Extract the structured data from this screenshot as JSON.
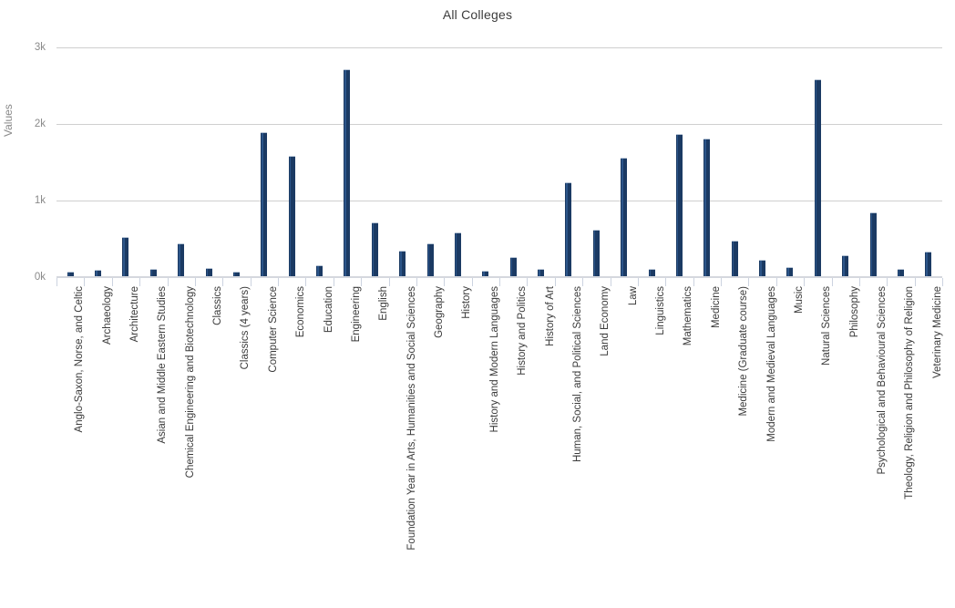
{
  "chart": {
    "title": "All Colleges",
    "ylabel": "Values",
    "ytick_labels": [
      "3k",
      "2k",
      "1k",
      "0k"
    ]
  },
  "chart_data": {
    "type": "bar",
    "title": "All Colleges",
    "xlabel": "",
    "ylabel": "Values",
    "ylim": [
      0,
      3000
    ],
    "yticks": [
      0,
      1000,
      2000,
      3000
    ],
    "ytick_labels": [
      "0k",
      "1k",
      "2k",
      "3k"
    ],
    "grid": true,
    "legend": false,
    "bar_color": "#1b3a63",
    "categories": [
      "Anglo-Saxon, Norse, and Celtic",
      "Archaeology",
      "Architecture",
      "Asian and Middle Eastern Studies",
      "Chemical Engineering and Biotechnology",
      "Classics",
      "Classics (4 years)",
      "Computer Science",
      "Economics",
      "Education",
      "Engineering",
      "English",
      "Foundation Year in Arts, Humanities and Social Sciences",
      "Geography",
      "History",
      "History and Modern Languages",
      "History and Politics",
      "History of Art",
      "Human, Social, and Political Sciences",
      "Land Economy",
      "Law",
      "Linguistics",
      "Mathematics",
      "Medicine",
      "Medicine (Graduate course)",
      "Modern and Medieval Languages",
      "Music",
      "Natural Sciences",
      "Philosophy",
      "Psychological and Behavioural Sciences",
      "Theology, Religion and Philosophy of Religion",
      "Veterinary Medicine"
    ],
    "values": [
      75,
      90,
      520,
      105,
      440,
      120,
      75,
      1895,
      1580,
      155,
      2715,
      720,
      350,
      440,
      585,
      85,
      265,
      105,
      1240,
      620,
      1565,
      110,
      1870,
      1810,
      480,
      225,
      130,
      2580,
      285,
      845,
      110,
      335
    ]
  }
}
